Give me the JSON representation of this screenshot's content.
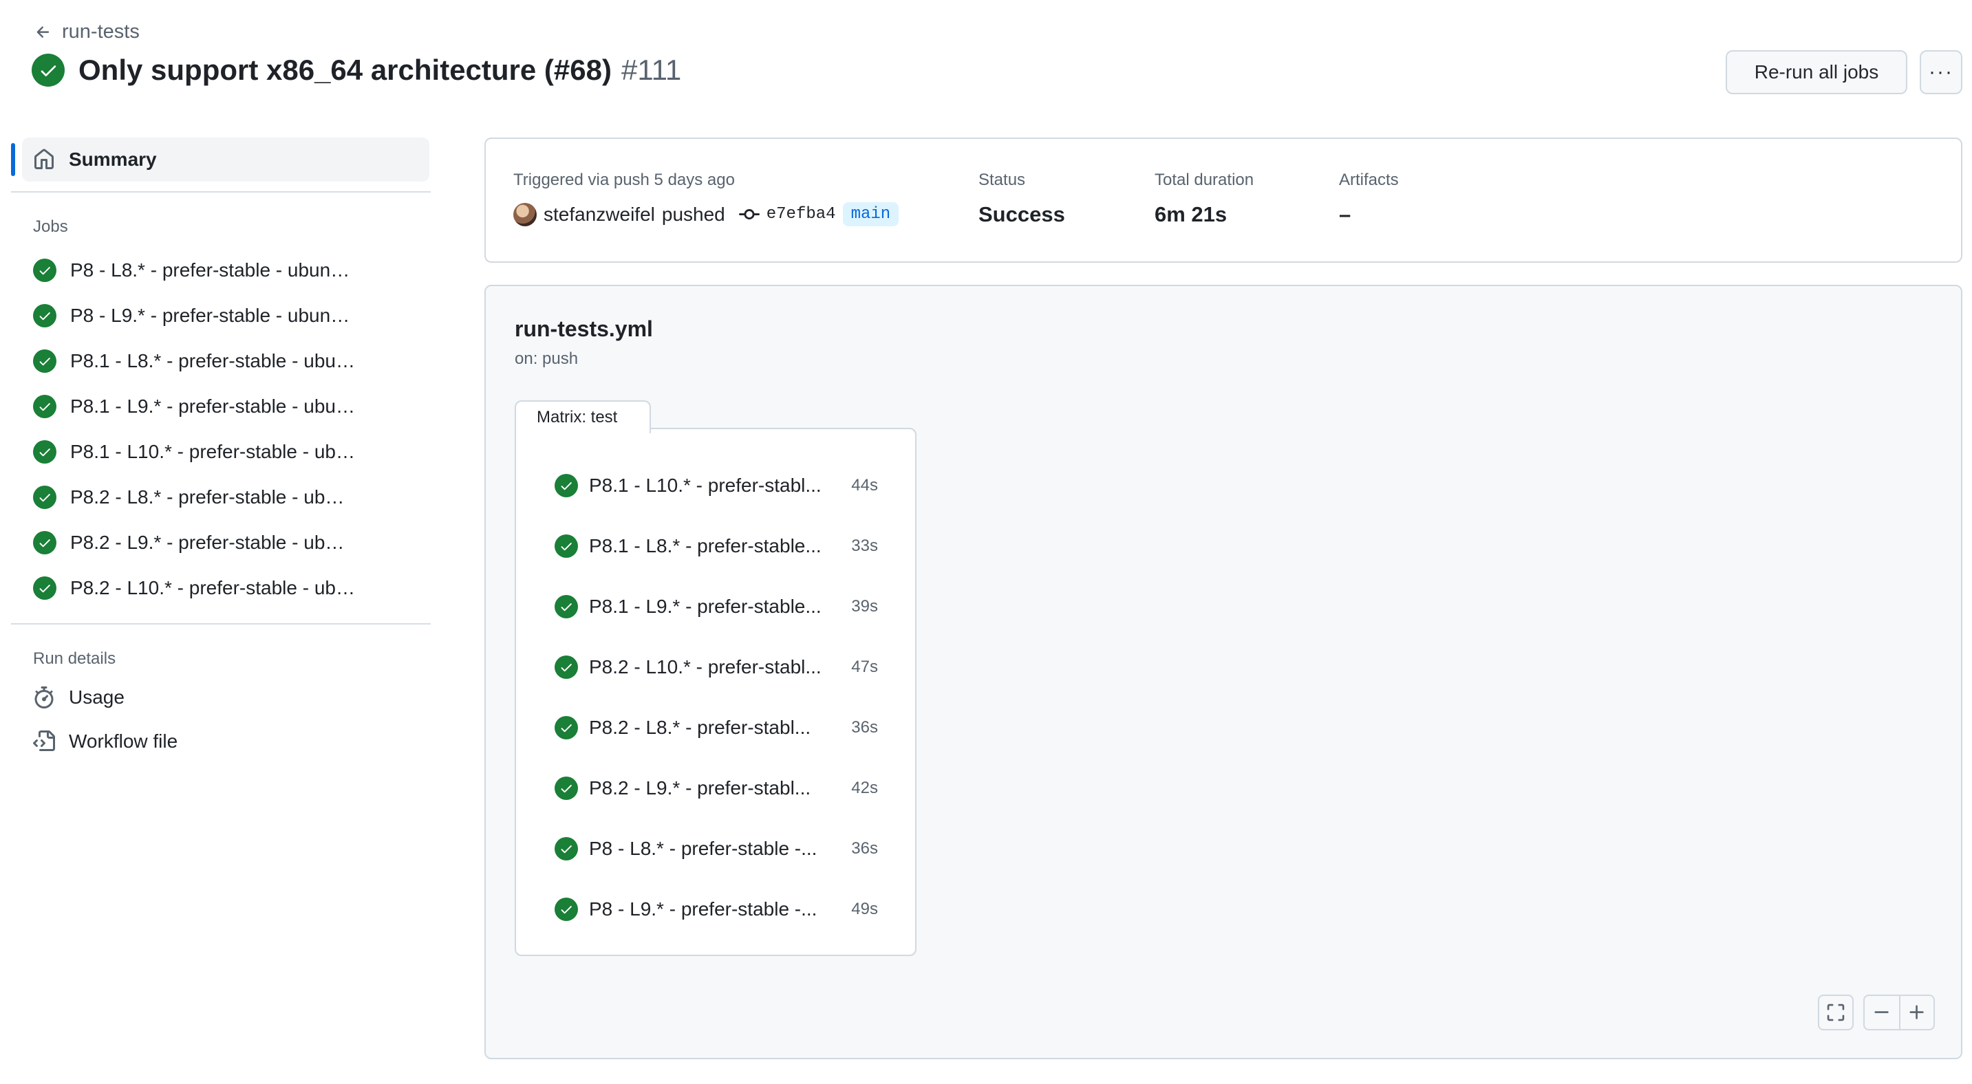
{
  "header": {
    "back_label": "run-tests",
    "title": "Only support x86_64 architecture (#68)",
    "run_number": "#111",
    "rerun_label": "Re-run all jobs",
    "more_label": "···"
  },
  "sidebar": {
    "summary_label": "Summary",
    "jobs_heading": "Jobs",
    "jobs": [
      {
        "label": "P8 - L8.* - prefer-stable - ubun…",
        "status": "success"
      },
      {
        "label": "P8 - L9.* - prefer-stable - ubun…",
        "status": "success"
      },
      {
        "label": "P8.1 - L8.* - prefer-stable - ubu…",
        "status": "success"
      },
      {
        "label": "P8.1 - L9.* - prefer-stable - ubu…",
        "status": "success"
      },
      {
        "label": "P8.1 - L10.* - prefer-stable - ub…",
        "status": "success"
      },
      {
        "label": "P8.2 - L8.* - prefer-stable - ub…",
        "status": "success"
      },
      {
        "label": "P8.2 - L9.* - prefer-stable - ub…",
        "status": "success"
      },
      {
        "label": "P8.2 - L10.* - prefer-stable - ub…",
        "status": "success"
      }
    ],
    "run_details_heading": "Run details",
    "usage_label": "Usage",
    "workflow_file_label": "Workflow file"
  },
  "summary": {
    "trigger_label": "Triggered via push 5 days ago",
    "actor": "stefanzweifel",
    "actor_action": "pushed",
    "commit_sha": "e7efba4",
    "branch": "main",
    "status_label": "Status",
    "status_value": "Success",
    "duration_label": "Total duration",
    "duration_value": "6m 21s",
    "artifacts_label": "Artifacts",
    "artifacts_value": "–"
  },
  "workflow": {
    "name": "run-tests.yml",
    "trigger": "on: push",
    "matrix_label": "Matrix: test",
    "matrix_jobs": [
      {
        "label": "P8.1 - L10.* - prefer-stabl...",
        "duration": "44s"
      },
      {
        "label": "P8.1 - L8.* - prefer-stable...",
        "duration": "33s"
      },
      {
        "label": "P8.1 - L9.* - prefer-stable...",
        "duration": "39s"
      },
      {
        "label": "P8.2 - L10.* - prefer-stabl...",
        "duration": "47s"
      },
      {
        "label": "P8.2 - L8.* - prefer-stabl...",
        "duration": "36s"
      },
      {
        "label": "P8.2 - L9.* - prefer-stabl...",
        "duration": "42s"
      },
      {
        "label": "P8 - L8.* - prefer-stable -...",
        "duration": "36s"
      },
      {
        "label": "P8 - L9.* - prefer-stable -...",
        "duration": "49s"
      }
    ]
  },
  "colors": {
    "success": "#1a7f37",
    "accent": "#0969da",
    "border": "#d1d9e0"
  },
  "icons": {
    "back": "arrow-left-icon",
    "status": "check-circle-icon",
    "home": "home-icon",
    "usage": "stopwatch-icon",
    "workflow_file": "file-code-icon",
    "commit": "git-commit-icon",
    "fullscreen": "screen-full-icon",
    "zoom_out": "dash-icon",
    "zoom_in": "plus-icon"
  }
}
